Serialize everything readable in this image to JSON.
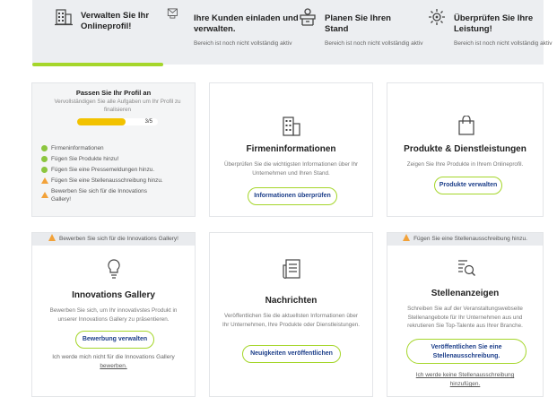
{
  "steps": [
    {
      "title": "Verwalten Sie Ihr Onlineprofil!",
      "icon": "building-icon",
      "subtitle": ""
    },
    {
      "title": "Ihre Kunden einladen und verwalten.",
      "icon": "invite-icon",
      "subtitle": "Bereich ist noch nicht vollständig aktiv"
    },
    {
      "title": "Planen Sie Ihren Stand",
      "icon": "stand-icon",
      "subtitle": "Bereich ist noch nicht vollständig aktiv"
    },
    {
      "title": "Überprüfen Sie Ihre Leistung!",
      "icon": "performance-icon",
      "subtitle": "Bereich ist noch nicht vollständig aktiv"
    }
  ],
  "profile": {
    "title": "Passen Sie Ihr Profil an",
    "subtitle": "Vervollständigen Sie alle Aufgaben um Ihr Profil zu finalisieren",
    "progress_label": "3/5",
    "progress_fraction": 0.6,
    "tasks": [
      {
        "label": "Firmeninformationen",
        "status": "done"
      },
      {
        "label": "Fügen Sie Produkte hinzu!",
        "status": "done"
      },
      {
        "label": "Fügen Sie eine Pressemeldungen hinzu.",
        "status": "done"
      },
      {
        "label": "Fügen Sie eine Stellenausschreibung hinzu.",
        "status": "warning"
      },
      {
        "label": "Bewerben Sie sich für die Innovations Gallery!",
        "status": "warning"
      }
    ]
  },
  "firmen": {
    "title": "Firmeninformationen",
    "desc": "Überprüfen Sie die wichtigsten Informationen über Ihr Unternehmen und Ihren Stand.",
    "button": "Informationen überprüfen"
  },
  "produkte": {
    "title": "Produkte & Dienstleistungen",
    "desc": "Zeigen Sie Ihre Produkte in Ihrem Onlineprofil.",
    "button": "Produkte verwalten"
  },
  "innovations": {
    "banner": "Bewerben Sie sich für die Innovations Gallery!",
    "title": "Innovations Gallery",
    "desc": "Bewerben Sie sich, um Ihr innovativstes Produkt in unserer Innovations Gallery zu präsentieren.",
    "button": "Bewerbung verwalten",
    "link_prefix": "Ich werde mich nicht für die Innovations Gallery",
    "link": "bewerben."
  },
  "nachrichten": {
    "title": "Nachrichten",
    "desc": "Veröffentlichen Sie die aktuellsten Informationen über Ihr Unternehmen, Ihre Produkte oder Dienstleistungen.",
    "button": "Neuigkeiten veröffentlichen"
  },
  "stellen": {
    "banner": "Fügen Sie eine Stellenausschreibung hinzu.",
    "title": "Stellenanzeigen",
    "desc": "Schreiben Sie auf der Veranstaltungswebseite Stellenangebote für Ihr Unternehmen aus und rekrutieren Sie Top-Talente aus Ihrer Branche.",
    "button_line1": "Veröffentlichen Sie eine",
    "button_line2": "Stellenausschreibung.",
    "link_line1": "Ich werde keine Stellenausschreibung",
    "link_line2": "hinzufügen."
  },
  "colors": {
    "accent": "#a5d62a",
    "warning": "#f2a23a",
    "done": "#8cc63f",
    "progress": "#f2c200",
    "button_text": "#1d3f8a"
  }
}
